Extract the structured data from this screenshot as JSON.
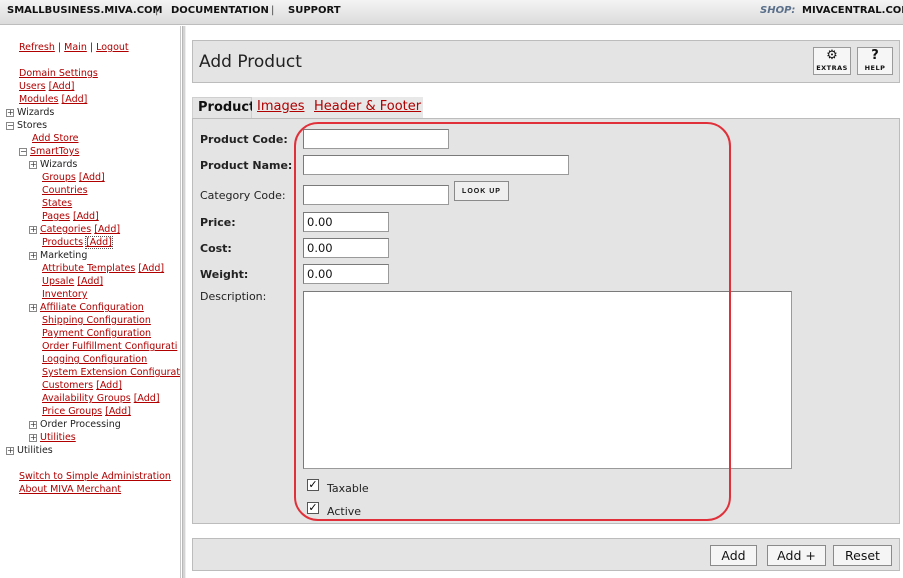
{
  "topbar": {
    "site": "SMALLBUSINESS.MIVA.COM",
    "documentation": "DOCUMENTATION",
    "support": "SUPPORT",
    "shop_label": "SHOP:",
    "shop_name": "MIVACENTRAL.COM"
  },
  "leftnav": {
    "refresh": "Refresh",
    "main": "Main",
    "logout": "Logout",
    "sep": "|",
    "domain_settings": "Domain Settings",
    "users": "Users",
    "modules": "Modules",
    "add": "[Add]",
    "wizards": "Wizards",
    "stores": "Stores",
    "add_store": "Add Store",
    "smarttoys": "SmartToys",
    "store_items": {
      "wizards": "Wizards",
      "groups": "Groups",
      "countries": "Countries",
      "states": "States",
      "pages": "Pages",
      "categories": "Categories",
      "products": "Products",
      "marketing": "Marketing",
      "attribute_templates": "Attribute Templates",
      "upsale": "Upsale",
      "inventory": "Inventory",
      "affiliate_configuration": "Affiliate Configuration",
      "shipping_configuration": "Shipping Configuration",
      "payment_configuration": "Payment Configuration",
      "order_fulfillment": "Order Fulfillment Configurati",
      "logging_configuration": "Logging Configuration",
      "system_extension": "System Extension Configurat",
      "customers": "Customers",
      "availability_groups": "Availability Groups",
      "price_groups": "Price Groups",
      "order_processing": "Order Processing",
      "utilities": "Utilities"
    },
    "utilities": "Utilities",
    "switch_simple": "Switch to Simple Administration",
    "about": "About MIVA Merchant",
    "expand_glyph": "+",
    "collapse_glyph": "−"
  },
  "header": {
    "title": "Add Product",
    "extras_label": "EXTRAS",
    "help_label": "HELP",
    "help_glyph": "?",
    "extras_glyph": "⚙"
  },
  "tabs": {
    "product": "Product",
    "images": "Images",
    "header_footer": "Header & Footer"
  },
  "form": {
    "product_code_label": "Product Code:",
    "product_code_value": "",
    "product_name_label": "Product Name:",
    "product_name_value": "",
    "category_code_label": "Category Code:",
    "category_code_value": "",
    "lookup_label": "LOOK UP",
    "price_label": "Price:",
    "price_value": "0.00",
    "cost_label": "Cost:",
    "cost_value": "0.00",
    "weight_label": "Weight:",
    "weight_value": "0.00",
    "description_label": "Description:",
    "description_value": "",
    "taxable_label": "Taxable",
    "taxable_checked": true,
    "active_label": "Active",
    "active_checked": true,
    "check_glyph": "✓"
  },
  "footer": {
    "add": "Add",
    "add_plus": "Add +",
    "reset": "Reset"
  },
  "colors": {
    "link": "#b00000",
    "panel": "#e4e4e4",
    "highlight": "#e0303a"
  }
}
